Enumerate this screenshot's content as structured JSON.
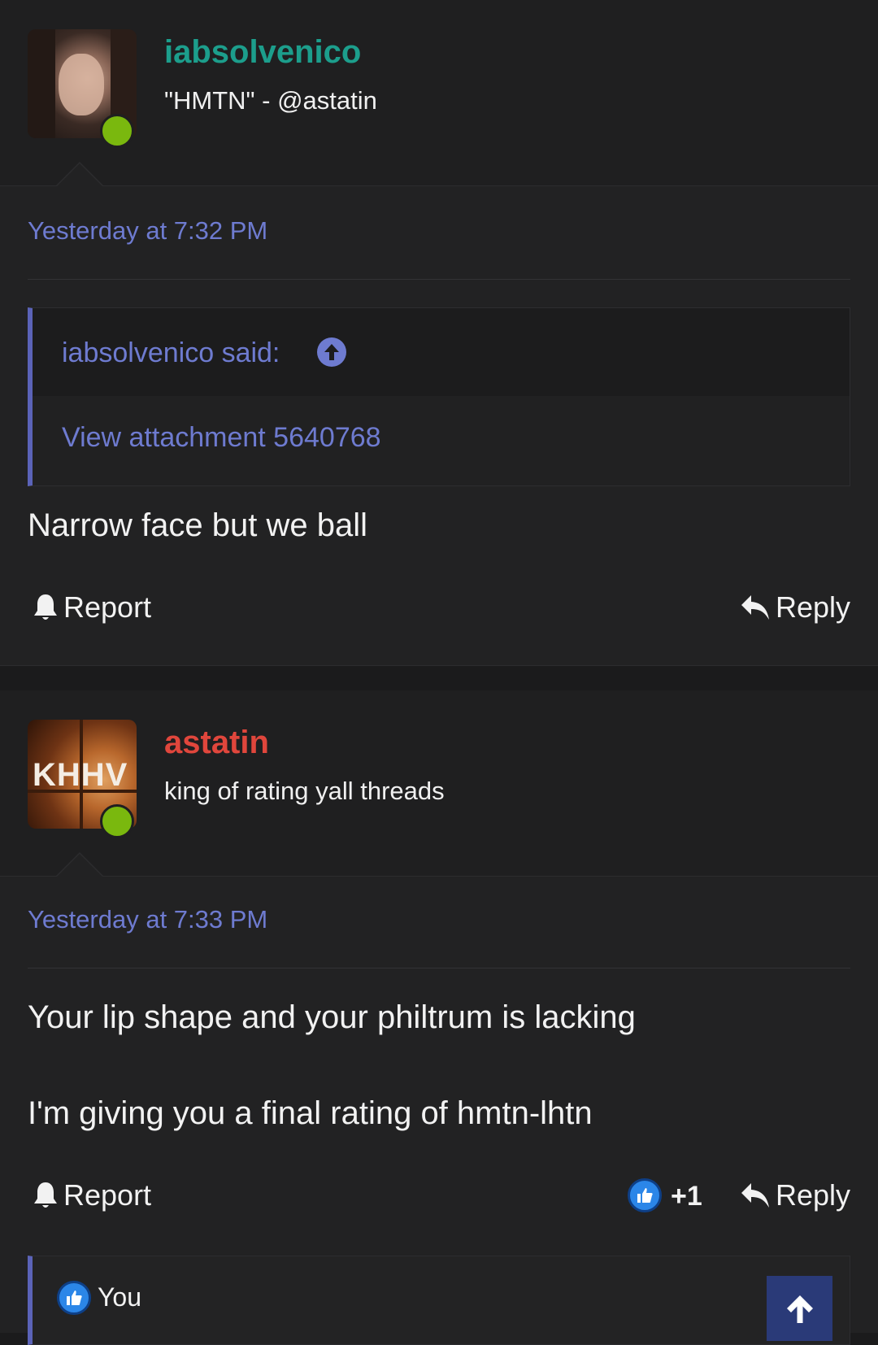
{
  "colors": {
    "background": "#1b1b1c",
    "post_background": "#222223",
    "link": "#6e7bd0",
    "username_1": "#1c9e8c",
    "username_2": "#e0463c",
    "online": "#7ab80e",
    "like": "#2b86e8",
    "scroll_top": "#2a3a78"
  },
  "posts": [
    {
      "username": "iabsolvenico",
      "user_title": "\"HMTN\" - @astatin",
      "timestamp": "Yesterday at 7:32 PM",
      "quote": {
        "author": "iabsolvenico said:",
        "attachment": "View attachment 5640768"
      },
      "message": [
        "Narrow face but we ball"
      ],
      "actions": {
        "report": "Report",
        "reply": "Reply"
      }
    },
    {
      "username": "astatin",
      "user_title": "king of rating yall threads",
      "avatar_text": "KHHV",
      "timestamp": "Yesterday at 7:33 PM",
      "message": [
        "Your lip shape and your philtrum is lacking",
        "I'm giving you a final rating of hmtn-lhtn"
      ],
      "actions": {
        "report": "Report",
        "reply": "Reply",
        "reaction_count": "+1"
      },
      "reactions_by": "You"
    }
  ],
  "icons": {
    "online": "online-status-icon",
    "bell": "bell-icon",
    "reply": "reply-arrow-icon",
    "like": "thumbs-up-icon",
    "quote_up": "arrow-up-circle-icon",
    "scroll_top": "arrow-up-icon"
  }
}
